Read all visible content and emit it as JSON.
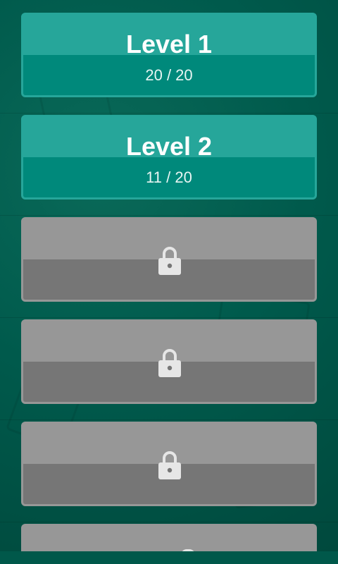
{
  "levels": [
    {
      "title": "Level 1",
      "progress": "20 / 20",
      "locked": false
    },
    {
      "title": "Level 2",
      "progress": "11 / 20",
      "locked": false
    },
    {
      "title": "",
      "progress": "",
      "locked": true
    },
    {
      "title": "",
      "progress": "",
      "locked": true
    },
    {
      "title": "",
      "progress": "",
      "locked": true
    },
    {
      "title": "",
      "progress": "",
      "locked": true
    }
  ],
  "icons": {
    "lock": "lock-icon"
  },
  "colors": {
    "background": "#00584a",
    "unlocked_top": "#26a69a",
    "unlocked_bottom": "#00897b",
    "locked_top": "#979797",
    "locked_bottom": "#767676",
    "text": "#ffffff"
  }
}
